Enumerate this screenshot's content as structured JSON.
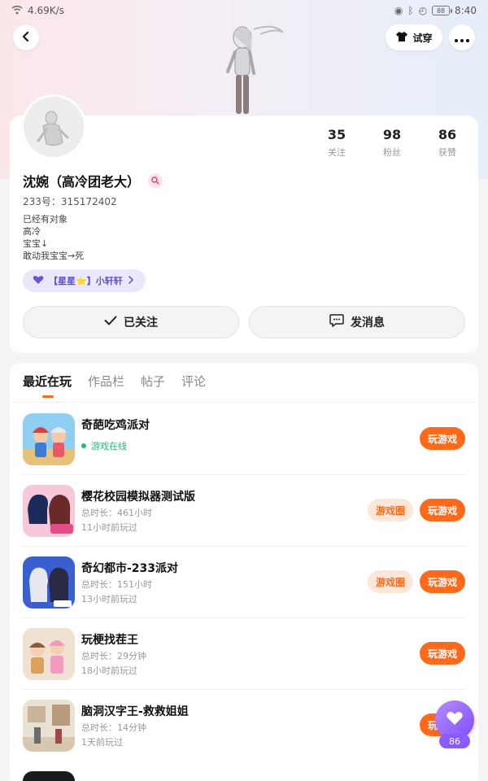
{
  "statusbar": {
    "speed": "4.69K/s",
    "battery": "88",
    "time": "8:40"
  },
  "nav": {
    "tryon_label": "试穿"
  },
  "profile": {
    "name": "沈婉（高冷团老大）",
    "user_id": "233号：315172402",
    "bio": [
      "已经有对象",
      "高冷",
      "宝宝↓",
      "敢动我宝宝→死"
    ],
    "friend_tag": "【星星⭐】小轩轩",
    "stats": [
      {
        "value": "35",
        "label": "关注"
      },
      {
        "value": "98",
        "label": "粉丝"
      },
      {
        "value": "86",
        "label": "获赞"
      }
    ],
    "follow_label": "已关注",
    "message_label": "发消息"
  },
  "tabs": [
    "最近在玩",
    "作品栏",
    "帖子",
    "评论"
  ],
  "games": [
    {
      "title": "奇葩吃鸡派对",
      "online_label": "游戏在线",
      "play_label": "玩游戏"
    },
    {
      "title": "樱花校园模拟器测试版",
      "duration": "总时长：461小时",
      "last_played": "11小时前玩过",
      "circle_label": "游戏圈",
      "play_label": "玩游戏"
    },
    {
      "title": "奇幻都市-233派对",
      "duration": "总时长：151小时",
      "last_played": "13小时前玩过",
      "circle_label": "游戏圈",
      "play_label": "玩游戏"
    },
    {
      "title": "玩梗找茬王",
      "duration": "总时长：29分钟",
      "last_played": "18小时前玩过",
      "play_label": "玩游戏"
    },
    {
      "title": "脑洞汉字王-救救姐姐",
      "duration": "总时长：14分钟",
      "last_played": "1天前玩过",
      "play_label": "玩游戏"
    }
  ],
  "fab": {
    "count": "86"
  },
  "colors": {
    "accent": "#ff6a1a",
    "online": "#1fbf73",
    "purple": "#8a5cff"
  }
}
